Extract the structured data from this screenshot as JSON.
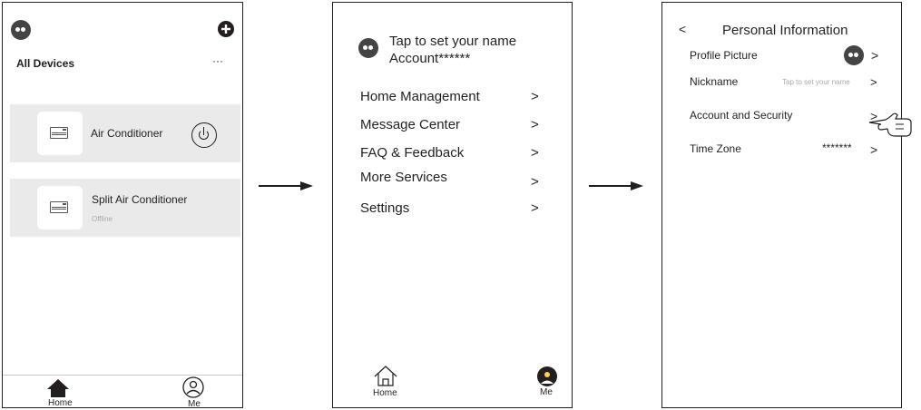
{
  "screen1": {
    "title": "All Devices",
    "more": "···",
    "add_icon": "plus-circle-icon",
    "devices": [
      {
        "name": "Air Conditioner",
        "status": "",
        "icon": "air-conditioner-icon",
        "power_icon": "power-icon"
      },
      {
        "name": "Split Air Conditioner",
        "status": "Offline",
        "icon": "air-conditioner-icon"
      }
    ],
    "tabbar": {
      "home": "Home",
      "me": "Me"
    }
  },
  "screen2": {
    "name_prompt": "Tap to set your name",
    "account": "Account******",
    "menu": [
      {
        "label": "Home Management",
        "chevron": ">"
      },
      {
        "label": "Message Center",
        "chevron": ">"
      },
      {
        "label": "FAQ & Feedback",
        "chevron": ">"
      },
      {
        "label": "More Services",
        "chevron": ">"
      },
      {
        "label": "Settings",
        "chevron": ">"
      }
    ],
    "tabbar": {
      "home": "Home",
      "me": "Me"
    }
  },
  "screen3": {
    "back": "<",
    "title": "Personal Information",
    "rows": [
      {
        "label": "Profile Picture",
        "value": "",
        "chevron": ">"
      },
      {
        "label": "Nickname",
        "value": "Tap to set your name",
        "chevron": ">"
      },
      {
        "label": "Account and Security",
        "value": "",
        "chevron": ">"
      },
      {
        "label": "Time Zone",
        "value": "*******",
        "chevron": ">"
      }
    ],
    "pointer_icon": "hand-pointer-icon"
  },
  "colors": {
    "card_bg": "#eaeaea",
    "text": "#231f20",
    "avatar": "#444444",
    "muted": "#aaaaaa"
  }
}
